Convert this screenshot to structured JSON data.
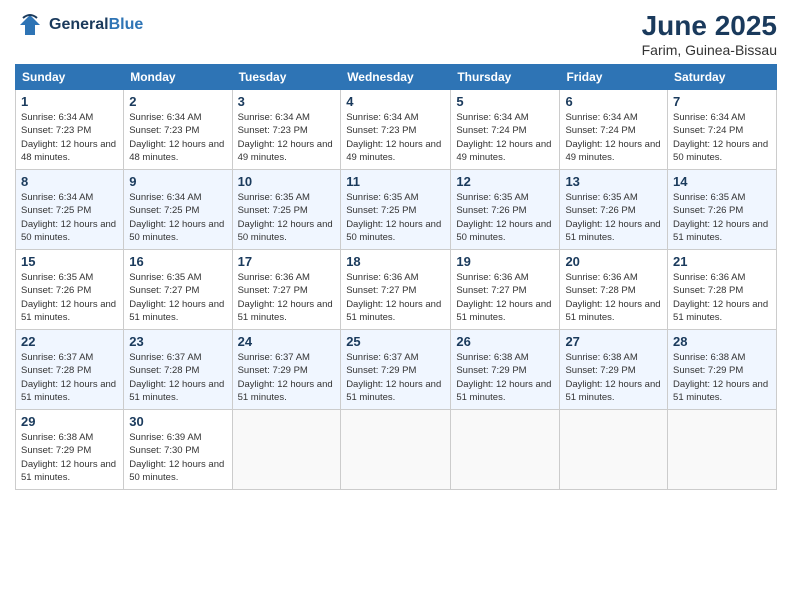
{
  "header": {
    "logo_general": "General",
    "logo_blue": "Blue",
    "month_title": "June 2025",
    "location": "Farim, Guinea-Bissau"
  },
  "weekdays": [
    "Sunday",
    "Monday",
    "Tuesday",
    "Wednesday",
    "Thursday",
    "Friday",
    "Saturday"
  ],
  "weeks": [
    [
      {
        "day": 1,
        "sunrise": "6:34 AM",
        "sunset": "7:23 PM",
        "daylight": "12 hours and 48 minutes."
      },
      {
        "day": 2,
        "sunrise": "6:34 AM",
        "sunset": "7:23 PM",
        "daylight": "12 hours and 48 minutes."
      },
      {
        "day": 3,
        "sunrise": "6:34 AM",
        "sunset": "7:23 PM",
        "daylight": "12 hours and 49 minutes."
      },
      {
        "day": 4,
        "sunrise": "6:34 AM",
        "sunset": "7:23 PM",
        "daylight": "12 hours and 49 minutes."
      },
      {
        "day": 5,
        "sunrise": "6:34 AM",
        "sunset": "7:24 PM",
        "daylight": "12 hours and 49 minutes."
      },
      {
        "day": 6,
        "sunrise": "6:34 AM",
        "sunset": "7:24 PM",
        "daylight": "12 hours and 49 minutes."
      },
      {
        "day": 7,
        "sunrise": "6:34 AM",
        "sunset": "7:24 PM",
        "daylight": "12 hours and 50 minutes."
      }
    ],
    [
      {
        "day": 8,
        "sunrise": "6:34 AM",
        "sunset": "7:25 PM",
        "daylight": "12 hours and 50 minutes."
      },
      {
        "day": 9,
        "sunrise": "6:34 AM",
        "sunset": "7:25 PM",
        "daylight": "12 hours and 50 minutes."
      },
      {
        "day": 10,
        "sunrise": "6:35 AM",
        "sunset": "7:25 PM",
        "daylight": "12 hours and 50 minutes."
      },
      {
        "day": 11,
        "sunrise": "6:35 AM",
        "sunset": "7:25 PM",
        "daylight": "12 hours and 50 minutes."
      },
      {
        "day": 12,
        "sunrise": "6:35 AM",
        "sunset": "7:26 PM",
        "daylight": "12 hours and 50 minutes."
      },
      {
        "day": 13,
        "sunrise": "6:35 AM",
        "sunset": "7:26 PM",
        "daylight": "12 hours and 51 minutes."
      },
      {
        "day": 14,
        "sunrise": "6:35 AM",
        "sunset": "7:26 PM",
        "daylight": "12 hours and 51 minutes."
      }
    ],
    [
      {
        "day": 15,
        "sunrise": "6:35 AM",
        "sunset": "7:26 PM",
        "daylight": "12 hours and 51 minutes."
      },
      {
        "day": 16,
        "sunrise": "6:35 AM",
        "sunset": "7:27 PM",
        "daylight": "12 hours and 51 minutes."
      },
      {
        "day": 17,
        "sunrise": "6:36 AM",
        "sunset": "7:27 PM",
        "daylight": "12 hours and 51 minutes."
      },
      {
        "day": 18,
        "sunrise": "6:36 AM",
        "sunset": "7:27 PM",
        "daylight": "12 hours and 51 minutes."
      },
      {
        "day": 19,
        "sunrise": "6:36 AM",
        "sunset": "7:27 PM",
        "daylight": "12 hours and 51 minutes."
      },
      {
        "day": 20,
        "sunrise": "6:36 AM",
        "sunset": "7:28 PM",
        "daylight": "12 hours and 51 minutes."
      },
      {
        "day": 21,
        "sunrise": "6:36 AM",
        "sunset": "7:28 PM",
        "daylight": "12 hours and 51 minutes."
      }
    ],
    [
      {
        "day": 22,
        "sunrise": "6:37 AM",
        "sunset": "7:28 PM",
        "daylight": "12 hours and 51 minutes."
      },
      {
        "day": 23,
        "sunrise": "6:37 AM",
        "sunset": "7:28 PM",
        "daylight": "12 hours and 51 minutes."
      },
      {
        "day": 24,
        "sunrise": "6:37 AM",
        "sunset": "7:29 PM",
        "daylight": "12 hours and 51 minutes."
      },
      {
        "day": 25,
        "sunrise": "6:37 AM",
        "sunset": "7:29 PM",
        "daylight": "12 hours and 51 minutes."
      },
      {
        "day": 26,
        "sunrise": "6:38 AM",
        "sunset": "7:29 PM",
        "daylight": "12 hours and 51 minutes."
      },
      {
        "day": 27,
        "sunrise": "6:38 AM",
        "sunset": "7:29 PM",
        "daylight": "12 hours and 51 minutes."
      },
      {
        "day": 28,
        "sunrise": "6:38 AM",
        "sunset": "7:29 PM",
        "daylight": "12 hours and 51 minutes."
      }
    ],
    [
      {
        "day": 29,
        "sunrise": "6:38 AM",
        "sunset": "7:29 PM",
        "daylight": "12 hours and 51 minutes."
      },
      {
        "day": 30,
        "sunrise": "6:39 AM",
        "sunset": "7:30 PM",
        "daylight": "12 hours and 50 minutes."
      },
      null,
      null,
      null,
      null,
      null
    ]
  ]
}
